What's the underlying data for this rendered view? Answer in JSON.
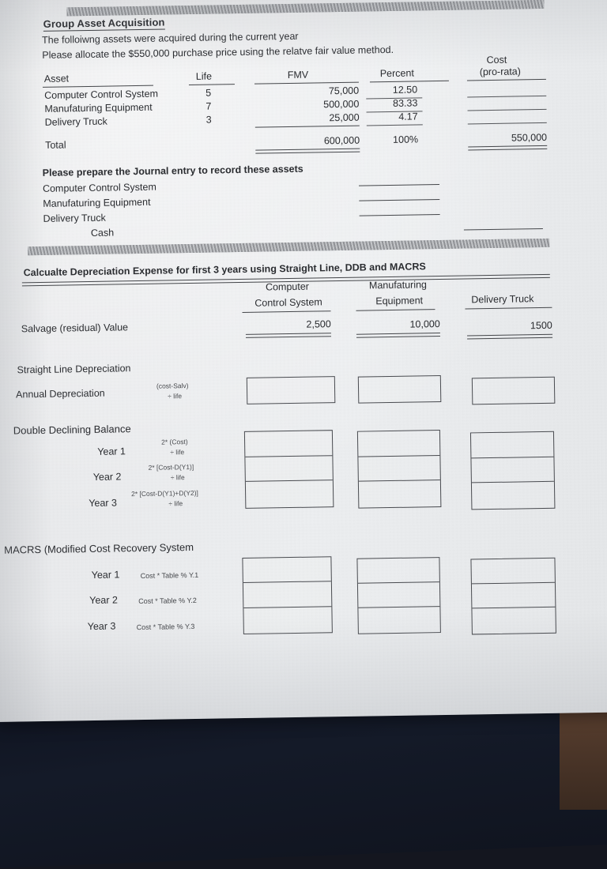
{
  "document": {
    "section1": {
      "title": "Group Asset Acquisition",
      "line1": "The folloiwng assets were acquired during the current year",
      "line2": "Please allocate the $550,000 purchase price using the relatve fair value method.",
      "table": {
        "headers": {
          "asset": "Asset",
          "life": "Life",
          "fmv": "FMV",
          "percent": "Percent",
          "cost_line1": "Cost",
          "cost_line2": "(pro-rata)"
        },
        "rows": [
          {
            "asset": "Computer Control System",
            "life": "5",
            "fmv": "75,000",
            "percent": "12.50",
            "cost": ""
          },
          {
            "asset": "Manufaturing Equipment",
            "life": "7",
            "fmv": "500,000",
            "percent": "83.33",
            "cost": ""
          },
          {
            "asset": "Delivery Truck",
            "life": "3",
            "fmv": "25,000",
            "percent": "4.17",
            "cost": ""
          }
        ],
        "total": {
          "label": "Total",
          "life": "",
          "fmv": "600,000",
          "percent": "100%",
          "cost": "550,000"
        }
      }
    },
    "section2": {
      "prompt": "Please prepare the Journal entry to record these assets",
      "lines": [
        "Computer Control System",
        "Manufaturing Equipment",
        "Delivery Truck"
      ],
      "credit_line": "Cash"
    },
    "section3": {
      "title": "Calcualte Depreciation Expense for first 3 years using Straight Line, DDB and MACRS",
      "columns": [
        {
          "line1": "Computer",
          "line2": "Control System"
        },
        {
          "line1": "Manufaturing",
          "line2": "Equipment"
        },
        {
          "line1": "",
          "line2": "Delivery Truck"
        }
      ],
      "salvage": {
        "label": "Salvage (residual) Value",
        "values": [
          "2,500",
          "10,000",
          "1500"
        ]
      },
      "straight_line": {
        "heading": "Straight Line Depreciation",
        "row_label": "Annual Depreciation",
        "formula_line1": "(cost-Salv)",
        "formula_line2": "÷ life"
      },
      "ddb": {
        "heading": "Double Declining Balance",
        "rows": [
          {
            "label": "Year 1",
            "formula_line1": "2* (Cost)",
            "formula_line2": "÷ life"
          },
          {
            "label": "Year 2",
            "formula_line1": "2* [Cost-D(Y1)]",
            "formula_line2": "÷ life"
          },
          {
            "label": "Year 3",
            "formula_line1": "2* [Cost-D(Y1)+D(Y2)]",
            "formula_line2": "÷ life"
          }
        ]
      },
      "macrs": {
        "heading": "MACRS (Modified Cost Recovery System",
        "rows": [
          {
            "label": "Year 1",
            "formula": "Cost * Table % Y.1"
          },
          {
            "label": "Year 2",
            "formula": "Cost * Table % Y.2"
          },
          {
            "label": "Year 3",
            "formula": "Cost * Table % Y.3"
          }
        ]
      }
    }
  }
}
